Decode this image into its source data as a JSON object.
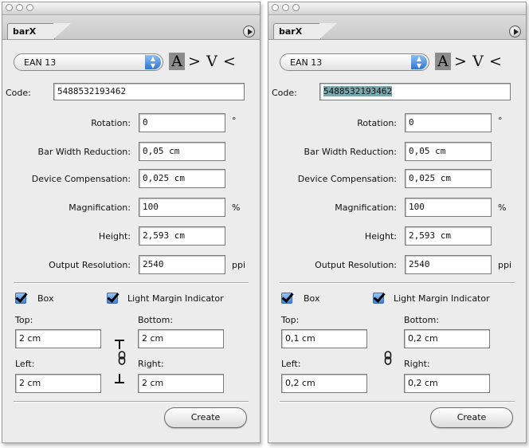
{
  "panels": [
    {
      "tab_label": "barX",
      "barcode_type": "EAN 13",
      "orientation_glyphs": [
        "A",
        ">",
        "V",
        "<"
      ],
      "code_label": "Code:",
      "code_value": "5488532193462",
      "rows": [
        {
          "label": "Rotation:",
          "value": "0",
          "unit": "°"
        },
        {
          "label": "Bar Width Reduction:",
          "value": "0,05 cm",
          "unit": ""
        },
        {
          "label": "Device Compensation:",
          "value": "0,025 cm",
          "unit": ""
        },
        {
          "label": "Magnification:",
          "value": "100",
          "unit": "%"
        },
        {
          "label": "Height:",
          "value": "2,593 cm",
          "unit": ""
        },
        {
          "label": "Output Resolution:",
          "value": "2540",
          "unit": "ppi"
        }
      ],
      "box_label": "Box",
      "light_margin_label": "Light Margin Indicator",
      "margins": {
        "top_label": "Top:",
        "top_value": "2 cm",
        "bottom_label": "Bottom:",
        "bottom_value": "2 cm",
        "left_label": "Left:",
        "left_value": "2 cm",
        "right_label": "Right:",
        "right_value": "2 cm"
      },
      "create_label": "Create"
    },
    {
      "tab_label": "barX",
      "barcode_type": "EAN 13",
      "orientation_glyphs": [
        "A",
        ">",
        "V",
        "<"
      ],
      "code_label": "Code:",
      "code_value": "5488532193462",
      "rows": [
        {
          "label": "Rotation:",
          "value": "0",
          "unit": "°"
        },
        {
          "label": "Bar Width Reduction:",
          "value": "0,05 cm",
          "unit": ""
        },
        {
          "label": "Device Compensation:",
          "value": "0,025 cm",
          "unit": ""
        },
        {
          "label": "Magnification:",
          "value": "100",
          "unit": "%"
        },
        {
          "label": "Height:",
          "value": "2,593 cm",
          "unit": ""
        },
        {
          "label": "Output Resolution:",
          "value": "2540",
          "unit": "ppi"
        }
      ],
      "box_label": "Box",
      "light_margin_label": "Light Margin Indicator",
      "margins": {
        "top_label": "Top:",
        "top_value": "0,1 cm",
        "bottom_label": "Bottom:",
        "bottom_value": "0,2 cm",
        "left_label": "Left:",
        "left_value": "0,2 cm",
        "right_label": "Right:",
        "right_value": "0,2 cm"
      },
      "create_label": "Create"
    }
  ]
}
